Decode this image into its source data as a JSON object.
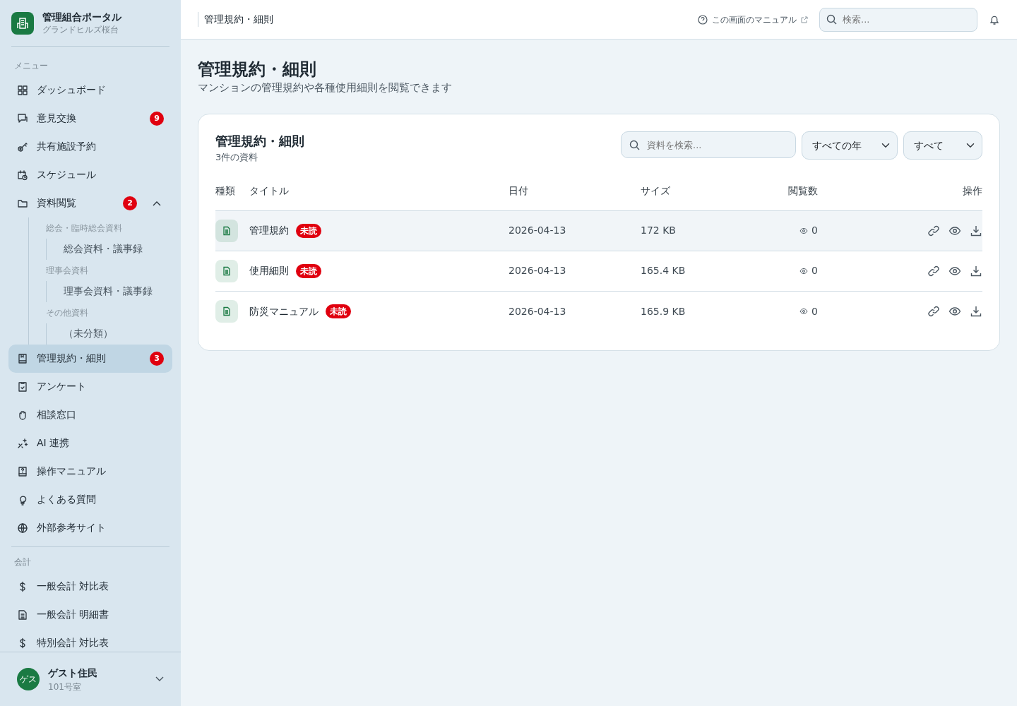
{
  "sidebar": {
    "brand": {
      "title": "管理組合ポータル",
      "subtitle": "グランドヒルズ桜台"
    },
    "sections": [
      {
        "label": "メニュー",
        "items": [
          {
            "label": "ダッシュボード",
            "selected": false
          },
          {
            "label": "意見交換",
            "badge": "9",
            "selected": false
          },
          {
            "label": "共有施設予約",
            "selected": false
          },
          {
            "label": "スケジュール",
            "selected": false
          },
          {
            "label": "資料閲覧",
            "badge": "2",
            "expanded": true,
            "selected": false,
            "groups": [
              {
                "label": "総会・臨時総会資料",
                "items": [
                  {
                    "label": "総会資料・議事録"
                  }
                ]
              },
              {
                "label": "理事会資料",
                "items": [
                  {
                    "label": "理事会資料・議事録"
                  }
                ]
              },
              {
                "label": "その他資料",
                "items": [
                  {
                    "label": "（未分類）"
                  }
                ]
              }
            ]
          },
          {
            "label": "管理規約・細則",
            "badge": "3",
            "selected": true
          },
          {
            "label": "アンケート",
            "selected": false
          },
          {
            "label": "相談窓口",
            "selected": false
          },
          {
            "label": "AI 連携",
            "selected": false
          },
          {
            "label": "操作マニュアル",
            "selected": false
          },
          {
            "label": "よくある質問",
            "selected": false
          },
          {
            "label": "外部参考サイト",
            "selected": false
          }
        ]
      },
      {
        "label": "会計",
        "items": [
          {
            "label": "一般会計 対比表",
            "selected": false
          },
          {
            "label": "一般会計 明細書",
            "selected": false
          },
          {
            "label": "特別会計 対比表",
            "selected": false
          }
        ]
      }
    ],
    "user": {
      "avatar": "ゲス",
      "name": "ゲスト住民",
      "room": "101号室"
    }
  },
  "header": {
    "breadcrumb": "管理規約・細則",
    "manual_link": "この画面のマニュアル",
    "search": {
      "placeholder": "検索..."
    }
  },
  "page": {
    "title": "管理規約・細則",
    "subtitle": "マンションの管理規約や各種使用細則を閲覧できます"
  },
  "card": {
    "title": "管理規約・細則",
    "count": "3件の資料",
    "search": {
      "placeholder": "資料を検索..."
    },
    "filters": [
      "すべての年",
      "すべて"
    ],
    "table": {
      "columns": [
        "種類",
        "タイトル",
        "日付",
        "サイズ",
        "閲覧数",
        "操作"
      ],
      "rows": [
        {
          "title": "管理規約",
          "unread": "未読",
          "date": "2026-04-13",
          "size": "172 KB",
          "views": "0",
          "selected": true
        },
        {
          "title": "使用細則",
          "unread": "未読",
          "date": "2026-04-13",
          "size": "165.4 KB",
          "views": "0",
          "selected": false
        },
        {
          "title": "防災マニュアル",
          "unread": "未読",
          "date": "2026-04-13",
          "size": "165.9 KB",
          "views": "0",
          "selected": false
        }
      ]
    }
  }
}
